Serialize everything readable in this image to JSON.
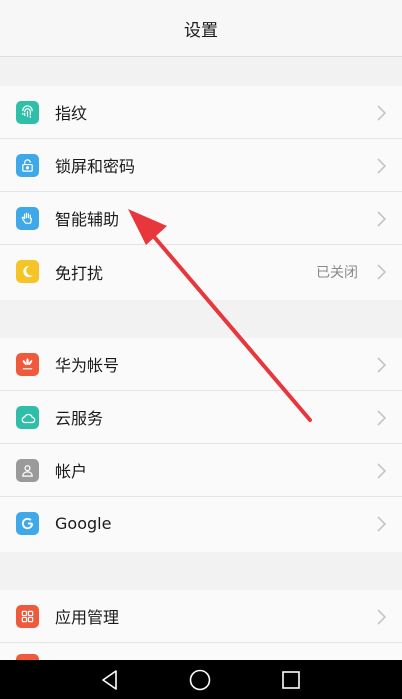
{
  "header": {
    "title": "设置"
  },
  "groups": [
    {
      "items": [
        {
          "label": "指纹",
          "icon": "fingerprint-icon",
          "color": "#2fbfa8"
        },
        {
          "label": "锁屏和密码",
          "icon": "lock-screen-icon",
          "color": "#3ea8e8"
        },
        {
          "label": "智能辅助",
          "icon": "hand-icon",
          "color": "#3ea8e8"
        },
        {
          "label": "免打扰",
          "icon": "moon-icon",
          "color": "#f5c528",
          "status": "已关闭"
        }
      ]
    },
    {
      "items": [
        {
          "label": "华为帐号",
          "icon": "huawei-icon",
          "color": "#f05a3c"
        },
        {
          "label": "云服务",
          "icon": "cloud-icon",
          "color": "#2fbfa8"
        },
        {
          "label": "帐户",
          "icon": "account-icon",
          "color": "#9a9a9a"
        },
        {
          "label": "Google",
          "icon": "google-icon",
          "color": "#3ea8e8"
        }
      ]
    },
    {
      "items": [
        {
          "label": "应用管理",
          "icon": "apps-icon",
          "color": "#f05a3c"
        }
      ]
    }
  ],
  "colors": {
    "arrow": "#e8373c",
    "chevron": "#c4c4c4"
  }
}
